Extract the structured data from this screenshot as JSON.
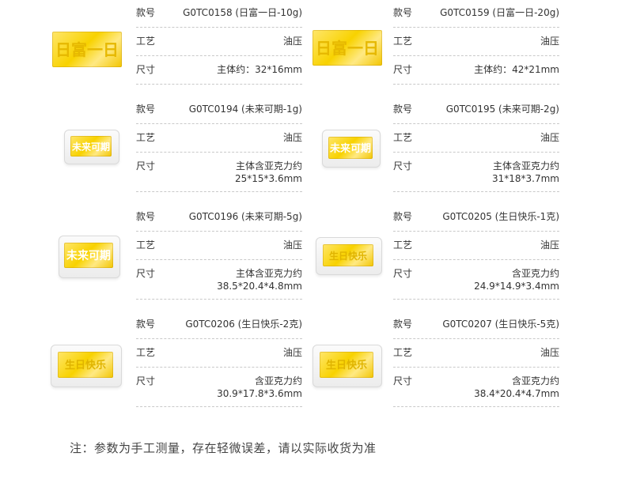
{
  "labels": {
    "model": "款号",
    "craft": "工艺",
    "size": "尺寸"
  },
  "products": [
    {
      "model": "G0TC0158 (日富一日-10g)",
      "craft": "油压",
      "size_line1": "主体约：32*16mm",
      "size_line2": "",
      "style": "plain"
    },
    {
      "model": "G0TC0159 (日富一日-20g)",
      "craft": "油压",
      "size_line1": "主体约：42*21mm",
      "size_line2": "",
      "style": "plain"
    },
    {
      "model": "G0TC0194 (未来可期-1g)",
      "craft": "油压",
      "size_line1": "主体含亚克力约",
      "size_line2": "25*15*3.6mm",
      "style": "acrylic"
    },
    {
      "model": "G0TC0195 (未来可期-2g)",
      "craft": "油压",
      "size_line1": "主体含亚克力约",
      "size_line2": "31*18*3.7mm",
      "style": "acrylic"
    },
    {
      "model": "G0TC0196 (未来可期-5g)",
      "craft": "油压",
      "size_line1": "主体含亚克力约",
      "size_line2": "38.5*20.4*4.8mm",
      "style": "acrylic"
    },
    {
      "model": "G0TC0205 (生日快乐-1克)",
      "craft": "油压",
      "size_line1": "含亚克力约",
      "size_line2": "24.9*14.9*3.4mm",
      "style": "acrylic"
    },
    {
      "model": "G0TC0206 (生日快乐-2克)",
      "craft": "油压",
      "size_line1": "含亚克力约",
      "size_line2": "30.9*17.8*3.6mm",
      "style": "acrylic"
    },
    {
      "model": "G0TC0207 (生日快乐-5克)",
      "craft": "油压",
      "size_line1": "含亚克力约",
      "size_line2": "38.4*20.4*4.7mm",
      "style": "acrylic"
    }
  ],
  "note": "注：参数为手工测量，存在轻微误差，请以实际收货为准",
  "colors": {
    "gold": "#f8d200",
    "divider": "#c9c9c9",
    "text": "#333333"
  }
}
